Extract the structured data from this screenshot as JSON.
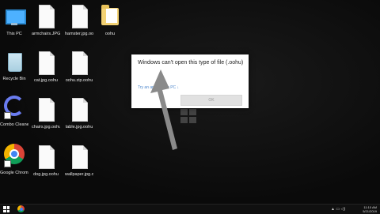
{
  "desktop": {
    "icons": [
      {
        "id": "this-pc",
        "label": "This PC"
      },
      {
        "id": "armchairs",
        "label": "armchairs.JPG.oohu"
      },
      {
        "id": "hamster",
        "label": "hamster.jpg.oohu"
      },
      {
        "id": "oohu-folder",
        "label": "oohu"
      },
      {
        "id": "recycle-bin",
        "label": "Recycle Bin"
      },
      {
        "id": "cat",
        "label": "cat.jpg.oohu"
      },
      {
        "id": "oohu-zip",
        "label": "oohu.zip.oohu"
      },
      {
        "id": "combo-cleaner",
        "label": "Combo Cleaner"
      },
      {
        "id": "chairs",
        "label": "chairs.jpg.oohu"
      },
      {
        "id": "table",
        "label": "table.jpg.oohu"
      },
      {
        "id": "google-chrome",
        "label": "Google Chrome"
      },
      {
        "id": "dog",
        "label": "dog.jpg.oohu"
      },
      {
        "id": "wallpaper",
        "label": "wallpaper.jpg.oohu"
      }
    ]
  },
  "dialog": {
    "title": "Windows can't open this type of file (.oohu)",
    "link": "Try an app on this PC ↓",
    "ok_label": "OK"
  },
  "taskbar": {
    "time": "11:10 AM",
    "date": "5/21/2019"
  }
}
